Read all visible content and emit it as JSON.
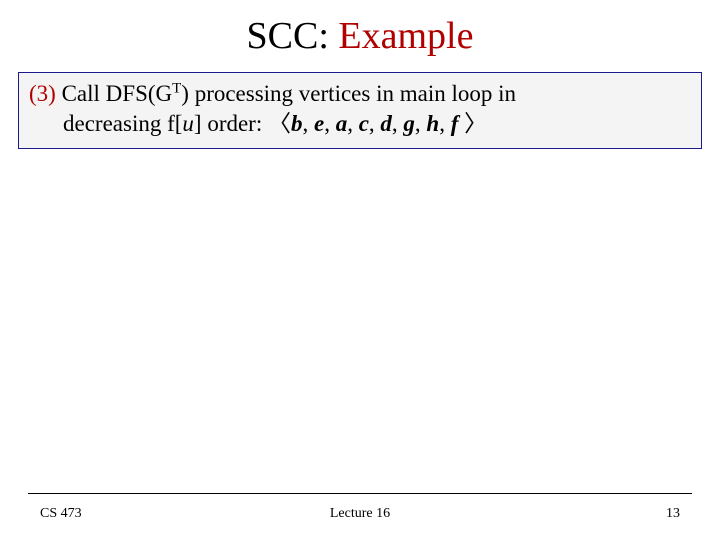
{
  "title": {
    "part1": "SCC: ",
    "part2": "Example"
  },
  "step": {
    "num": "(3)",
    "pre_dfs": " Call ",
    "dfs": "DFS",
    "after_dfs_open": "(G",
    "superscript": "T",
    "after_dfs_close": ") processing vertices in main loop in",
    "line2_pre": "decreasing f[",
    "line2_u": "u",
    "line2_mid": "] order: ",
    "angle_open": "〈",
    "seq": [
      "b",
      ", ",
      "e",
      ", ",
      "a",
      ", ",
      "c",
      ", ",
      "d",
      ", ",
      "g",
      ", ",
      "h",
      ", ",
      "f",
      " "
    ],
    "angle_close": "〉"
  },
  "footer": {
    "left": "CS 473",
    "center": "Lecture 16",
    "right": "13"
  }
}
